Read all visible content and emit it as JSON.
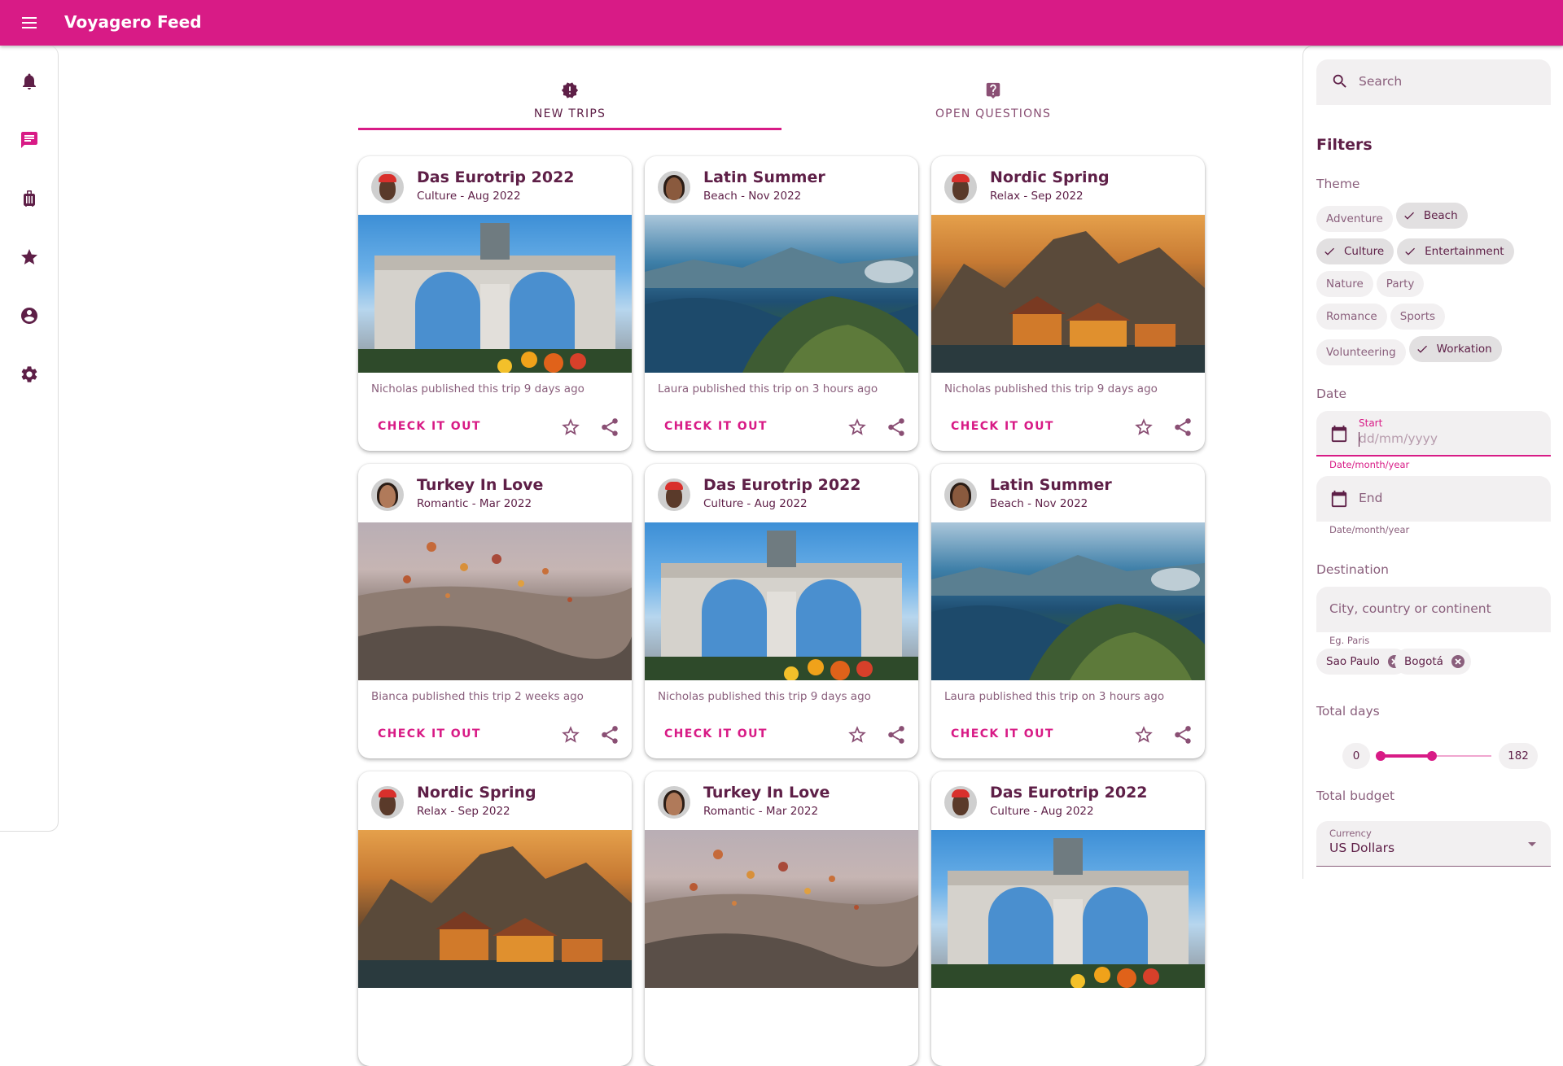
{
  "app": {
    "title": "Voyagero Feed"
  },
  "colors": {
    "primary": "#d81b86",
    "text": "#5e1f47",
    "muted": "#8a5f7c",
    "surface": "#f2f0f1"
  },
  "sidebar": {
    "items": [
      {
        "icon": "bell-icon",
        "label": "Notifications",
        "active": false
      },
      {
        "icon": "chat-icon",
        "label": "Messages",
        "active": true
      },
      {
        "icon": "luggage-icon",
        "label": "Trips",
        "active": false
      },
      {
        "icon": "star-icon",
        "label": "Favorites",
        "active": false
      },
      {
        "icon": "account-icon",
        "label": "Profile",
        "active": false
      },
      {
        "icon": "gear-icon",
        "label": "Settings",
        "active": false
      }
    ]
  },
  "tabs": [
    {
      "label": "NEW TRIPS",
      "icon": "new-releases-icon",
      "active": true
    },
    {
      "label": "OPEN QUESTIONS",
      "icon": "question-icon",
      "active": false
    }
  ],
  "cards": [
    {
      "title": "Das Eurotrip 2022",
      "subtitle": "Culture - Aug 2022",
      "published": "Nicholas published this trip 9 days ago",
      "cta": "CHECK IT OUT",
      "scene": "arch",
      "author": "nicholas"
    },
    {
      "title": "Latin Summer",
      "subtitle": "Beach - Nov 2022",
      "published": "Laura published this trip on 3 hours ago",
      "cta": "CHECK IT OUT",
      "scene": "coast",
      "author": "laura"
    },
    {
      "title": "Nordic Spring",
      "subtitle": "Relax - Sep 2022",
      "published": "Nicholas published this trip 9 days ago",
      "cta": "CHECK IT OUT",
      "scene": "nordic",
      "author": "nicholas"
    },
    {
      "title": "Turkey In Love",
      "subtitle": "Romantic - Mar 2022",
      "published": "Bianca published this trip 2 weeks ago",
      "cta": "CHECK IT OUT",
      "scene": "balloon",
      "author": "bianca"
    },
    {
      "title": "Das Eurotrip 2022",
      "subtitle": "Culture - Aug 2022",
      "published": "Nicholas published this trip 9 days ago",
      "cta": "CHECK IT OUT",
      "scene": "arch",
      "author": "nicholas"
    },
    {
      "title": "Latin Summer",
      "subtitle": "Beach - Nov 2022",
      "published": "Laura published this trip on 3 hours ago",
      "cta": "CHECK IT OUT",
      "scene": "coast",
      "author": "laura"
    },
    {
      "title": "Nordic Spring",
      "subtitle": "Relax - Sep 2022",
      "published": "",
      "cta": "",
      "scene": "nordic",
      "author": "nicholas"
    },
    {
      "title": "Turkey In Love",
      "subtitle": "Romantic - Mar 2022",
      "published": "",
      "cta": "",
      "scene": "balloon",
      "author": "bianca"
    },
    {
      "title": "Das Eurotrip 2022",
      "subtitle": "Culture - Aug 2022",
      "published": "",
      "cta": "",
      "scene": "arch",
      "author": "nicholas"
    }
  ],
  "filters": {
    "search_placeholder": "Search",
    "title": "Filters",
    "theme_label": "Theme",
    "themes": [
      {
        "label": "Adventure",
        "selected": false
      },
      {
        "label": "Beach",
        "selected": true
      },
      {
        "label": "Culture",
        "selected": true
      },
      {
        "label": "Entertainment",
        "selected": true
      },
      {
        "label": "Nature",
        "selected": false
      },
      {
        "label": "Party",
        "selected": false
      },
      {
        "label": "Romance",
        "selected": false
      },
      {
        "label": "Sports",
        "selected": false
      },
      {
        "label": "Volunteering",
        "selected": false
      },
      {
        "label": "Workation",
        "selected": true
      }
    ],
    "date_label": "Date",
    "start": {
      "label": "Start",
      "placeholder": "dd/mm/yyyy",
      "helper": "Date/month/year"
    },
    "end": {
      "label": "End",
      "helper": "Date/month/year"
    },
    "destination_label": "Destination",
    "destination_placeholder": "City, country or continent",
    "destination_helper": "Eg. Paris",
    "destinations": [
      "Sao Paulo",
      "Bogotá"
    ],
    "total_days_label": "Total days",
    "days": {
      "min": 0,
      "max": 182,
      "low_fraction": 0.0,
      "high_fraction": 0.46
    },
    "total_budget_label": "Total budget",
    "currency": {
      "label": "Currency",
      "value": "US Dollars"
    }
  }
}
